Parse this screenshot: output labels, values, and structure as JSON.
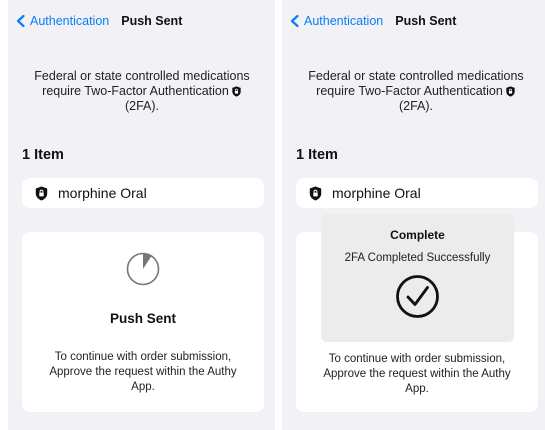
{
  "screens": [
    {
      "nav": {
        "back_label": "Authentication",
        "title": "Push Sent"
      },
      "notice": {
        "line1": "Federal or state controlled medications",
        "line2": "require Two-Factor Authentication",
        "line3": "(2FA)."
      },
      "item_count": "1 Item",
      "items": [
        {
          "label": "morphine Oral"
        }
      ],
      "card": {
        "title": "Push Sent",
        "desc_line1": "To continue with order submission,",
        "desc_line2": "Approve the request within the Authy",
        "desc_line3": "App."
      }
    },
    {
      "nav": {
        "back_label": "Authentication",
        "title": "Push Sent"
      },
      "notice": {
        "line1": "Federal or state controlled medications",
        "line2": "require Two-Factor Authentication",
        "line3": "(2FA)."
      },
      "item_count": "1 Item",
      "items": [
        {
          "label": "morphine Oral"
        }
      ],
      "card": {
        "desc_line1": "To continue with order submission,",
        "desc_line2": "Approve the request within the Authy",
        "desc_line3": "App."
      },
      "overlay": {
        "title": "Complete",
        "message": "2FA Completed Successfully"
      }
    }
  ],
  "icons": {
    "back": "chevron-left-icon",
    "lock": "shield-lock-icon",
    "spinner": "loading-spinner-icon",
    "success": "checkmark-circle-icon"
  },
  "colors": {
    "accent": "#0a7df5",
    "background": "#f2f2f6",
    "card": "#ffffff",
    "overlay": "#ececec"
  }
}
